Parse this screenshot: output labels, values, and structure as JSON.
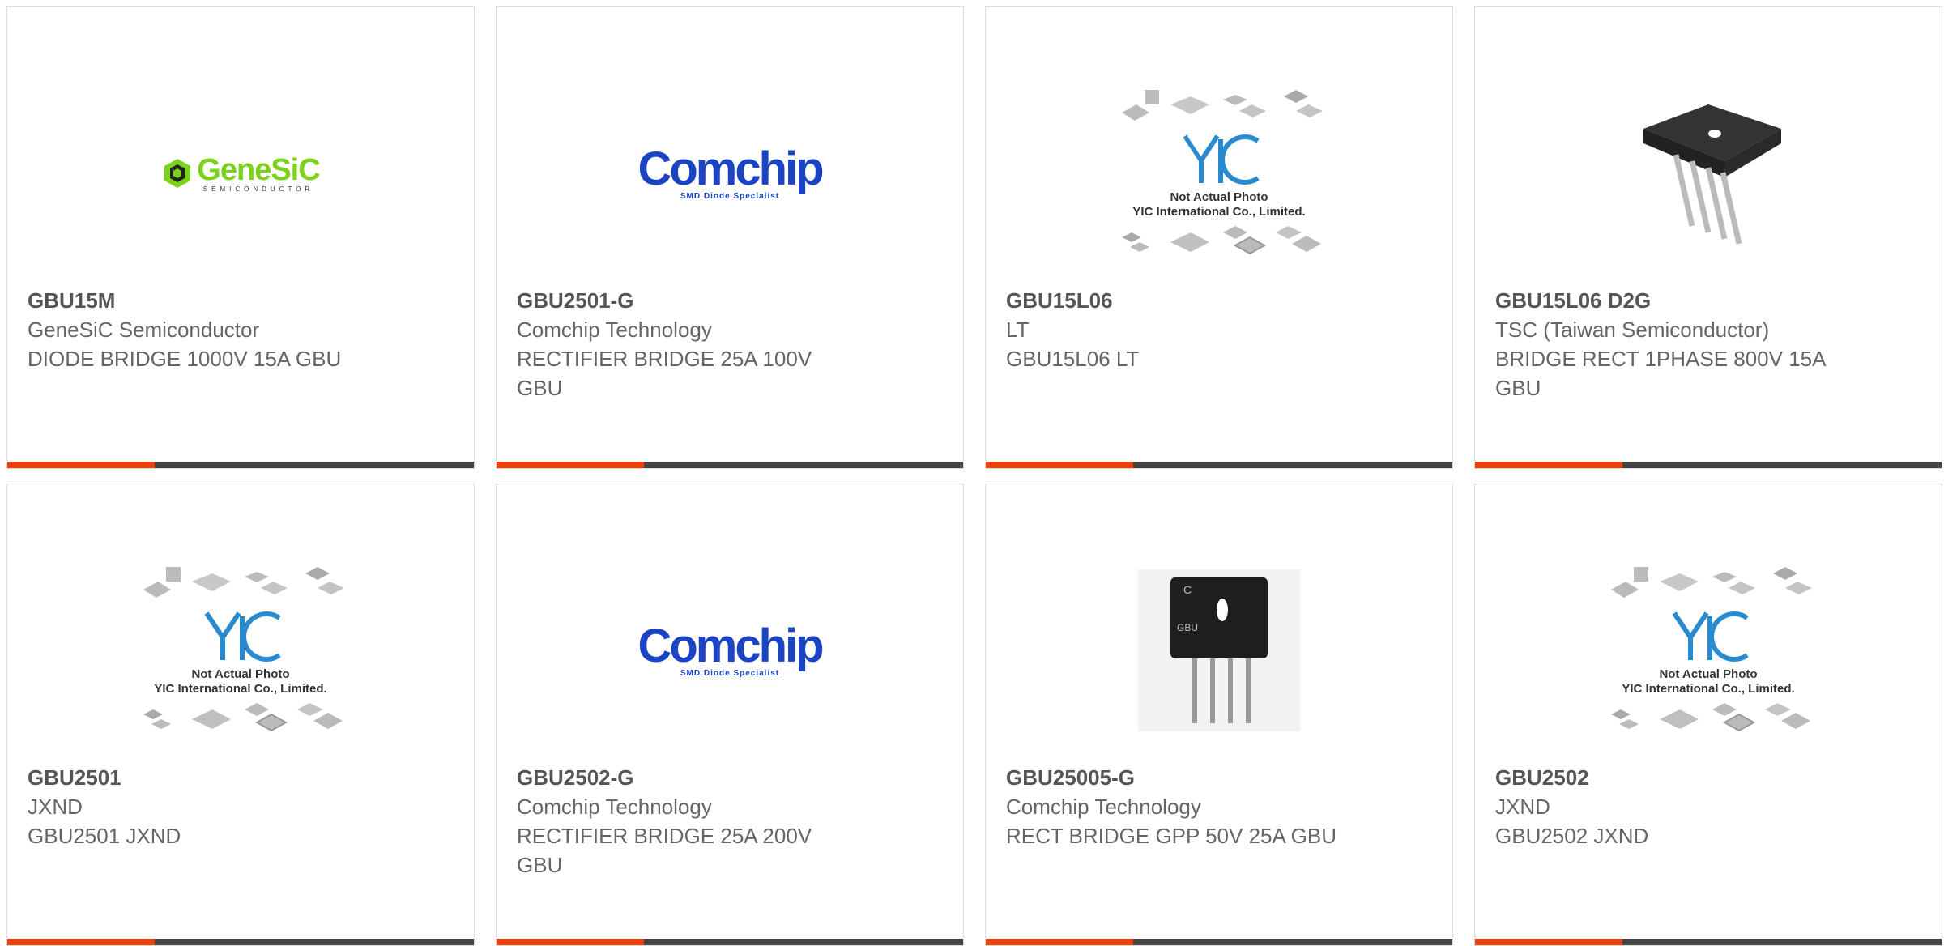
{
  "products": [
    {
      "part": "GBU15M",
      "manufacturer": "GeneSiC Semiconductor",
      "description": "DIODE BRIDGE 1000V 15A GBU",
      "image": "genesic-logo"
    },
    {
      "part": "GBU2501-G",
      "manufacturer": "Comchip Technology",
      "description": "RECTIFIER BRIDGE 25A 100V GBU",
      "image": "comchip-logo"
    },
    {
      "part": "GBU15L06",
      "manufacturer": "LT",
      "description": "GBU15L06 LT",
      "image": "yic-placeholder"
    },
    {
      "part": "GBU15L06 D2G",
      "manufacturer": "TSC (Taiwan Semiconductor)",
      "description": "BRIDGE RECT 1PHASE 800V 15A GBU",
      "image": "bridge-rectifier-photo"
    },
    {
      "part": "GBU2501",
      "manufacturer": "JXND",
      "description": "GBU2501 JXND",
      "image": "yic-placeholder"
    },
    {
      "part": "GBU2502-G",
      "manufacturer": "Comchip Technology",
      "description": "RECTIFIER BRIDGE 25A 200V GBU",
      "image": "comchip-logo"
    },
    {
      "part": "GBU25005-G",
      "manufacturer": "Comchip Technology",
      "description": "RECT BRIDGE GPP 50V 25A GBU",
      "image": "bridge-rectifier-photo"
    },
    {
      "part": "GBU2502",
      "manufacturer": "JXND",
      "description": "GBU2502 JXND",
      "image": "yic-placeholder"
    }
  ],
  "logos": {
    "genesic": {
      "name": "GeneSiC",
      "tagline": "SEMICONDUCTOR"
    },
    "comchip": {
      "name": "Comchip",
      "tagline": "SMD Diode Specialist"
    },
    "yic": {
      "name": "YIC",
      "line1": "Not Actual Photo",
      "line2": "YIC International Co., Limited."
    }
  },
  "colors": {
    "accent": "#e8410f",
    "bar": "#444444",
    "border": "#dcdcdc",
    "text": "#666666"
  }
}
